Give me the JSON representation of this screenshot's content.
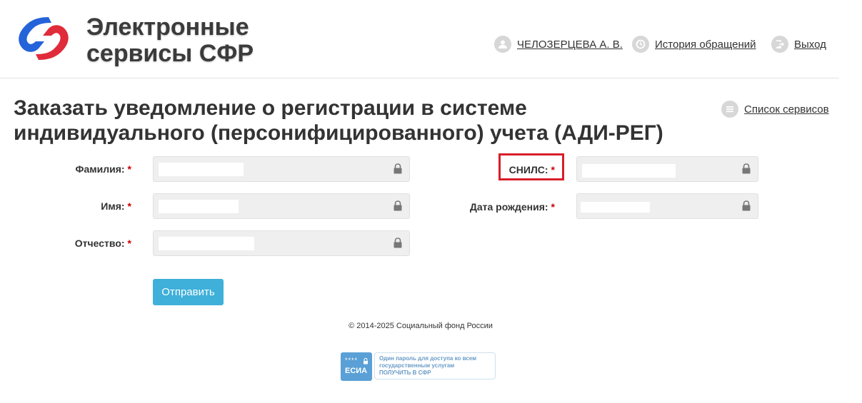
{
  "header": {
    "logo_line1": "Электронные",
    "logo_line2": "сервисы СФР",
    "user_name": "ЧЕЛОЗЕРЦЕВА А. В.",
    "history_label": "История обращений",
    "logout_label": "Выход"
  },
  "page": {
    "title": "Заказать уведомление о регистрации в системе индивидуального (персонифицированного) учета (АДИ-РЕГ)",
    "services_link": "Список сервисов"
  },
  "form": {
    "surname_label": "Фамилия:",
    "name_label": "Имя:",
    "patronymic_label": "Отчество:",
    "snils_label": "СНИЛС:",
    "birthdate_label": "Дата рождения:",
    "required_mark": "*",
    "submit_label": "Отправить"
  },
  "footer": {
    "copyright": "© 2014-2025 Социальный фонд России",
    "esia_stars": "****",
    "esia_name": "ЕСИА",
    "esia_line1": "Один пароль для доступа ко всем",
    "esia_line2": "государственным услугам",
    "esia_line3": "ПОЛУЧИТЬ В СФР"
  },
  "colors": {
    "accent": "#3eb0d9",
    "highlight": "#d81e2a",
    "required": "#cc0000"
  }
}
